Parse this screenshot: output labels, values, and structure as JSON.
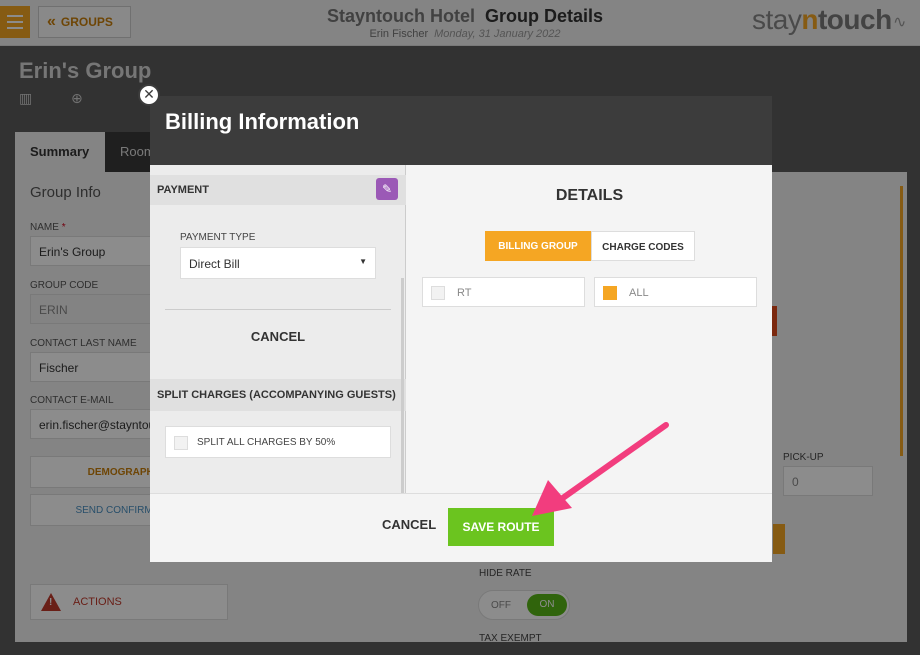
{
  "header": {
    "groups_label": "GROUPS",
    "hotel_name": "Stayntouch Hotel",
    "page_title": "Group Details",
    "user_name": "Erin Fischer",
    "date": "Monday, 31 January 2022",
    "logo_a": "stay",
    "logo_n": "n",
    "logo_b": "touch"
  },
  "page": {
    "group_name": "Erin's Group",
    "tabs": [
      "Summary",
      "Room"
    ],
    "group_info_title": "Group Info",
    "fields": {
      "name_label": "NAME",
      "name_value": "Erin's Group",
      "group_code_label": "GROUP CODE",
      "group_code_value": "ERIN",
      "contact_last_name_label": "CONTACT LAST NAME",
      "contact_last_name_value": "Fischer",
      "contact_email_label": "CONTACT E-MAIL",
      "contact_email_value": "erin.fischer@stayntouch.com"
    },
    "demographics_label": "DEMOGRAPHICS",
    "send_confirm_label": "SEND CONFIRMATION",
    "actions_label": "ACTIONS",
    "pickup_label": "PICK-UP",
    "pickup_value": "0",
    "hide_rate_label": "HIDE RATE",
    "toggle_off": "OFF",
    "toggle_on": "ON",
    "tax_exempt_label": "TAX EXEMPT"
  },
  "modal": {
    "title": "Billing Information",
    "payment_header": "PAYMENT",
    "payment_type_label": "PAYMENT TYPE",
    "payment_type_value": "Direct Bill",
    "cancel_left": "CANCEL",
    "split_header": "SPLIT CHARGES (ACCOMPANYING GUESTS)",
    "split_option": "SPLIT ALL CHARGES BY 50%",
    "details_title": "DETAILS",
    "segments": [
      "BILLING GROUP",
      "CHARGE CODES"
    ],
    "codes": [
      {
        "label": "RT",
        "checked": false
      },
      {
        "label": "ALL",
        "checked": true
      }
    ],
    "footer_cancel": "CANCEL",
    "save_route": "SAVE ROUTE"
  },
  "colors": {
    "accent_orange": "#f5a623",
    "save_green": "#6bc41f",
    "arrow_pink": "#f23d7e",
    "edit_purple": "#9b59b6"
  }
}
